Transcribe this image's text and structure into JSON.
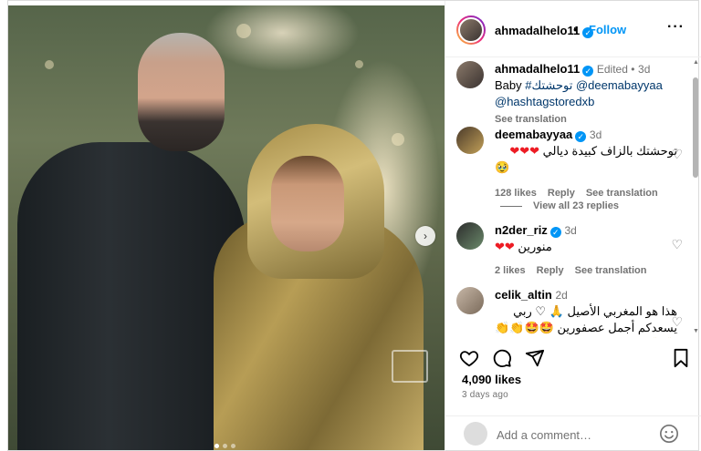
{
  "post": {
    "author": "ahmadalhelo11",
    "follow_label": "Follow",
    "separator": "•",
    "more_label": "···",
    "carousel": {
      "dots": 3,
      "active": 1,
      "next_label": "›"
    }
  },
  "caption": {
    "author": "ahmadalhelo11",
    "edited": "Edited •",
    "time": "3d",
    "text_1": "Baby ",
    "hashtag": "#توحشتك",
    "mention_1": " @deemabayyaa",
    "mention_2": "@hashtagstoredxb",
    "see_translation": "See translation"
  },
  "comments": [
    {
      "user": "deemabayyaa",
      "time": "3d",
      "text": "توحشتك بالزاف كبيدة ديالي ❤❤❤",
      "text_extra": "🥹",
      "likes": "128 likes",
      "reply": "Reply",
      "see_translation": "See translation",
      "view_replies": "View all 23 replies"
    },
    {
      "user": "n2der_riz",
      "time": "3d",
      "text": "منورين ❤❤",
      "likes": "2 likes",
      "reply": "Reply",
      "see_translation": "See translation"
    },
    {
      "user": "celik_altin",
      "time": "2d",
      "text_line1": "هذا هو المغربي الأصيل 🙏 ♡ ربي",
      "text_line2": "يسعدكم أجمل عصفورين 🤩🤩👏👏",
      "text_line3": "🙏🙏"
    }
  ],
  "engagement": {
    "likes": "4,090 likes",
    "time_ago": "3 days ago"
  },
  "add_comment": {
    "placeholder": "Add a comment…"
  },
  "colors": {
    "accent": "#0095f6",
    "heart_red": "#ed1c24",
    "muted": "#737373"
  }
}
